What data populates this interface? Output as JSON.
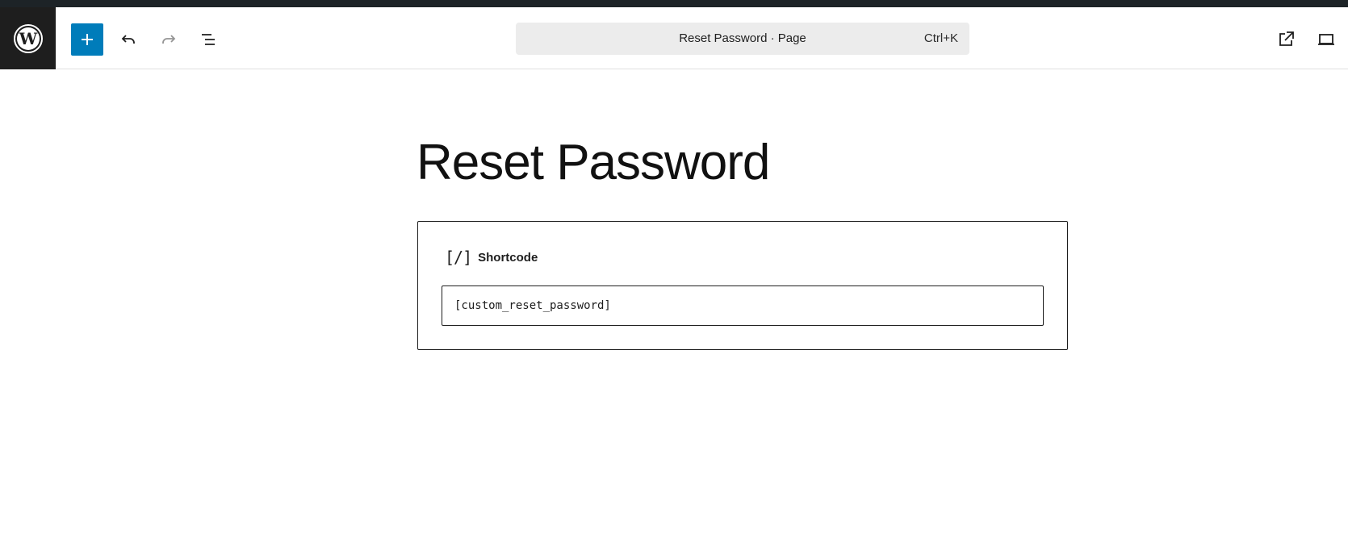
{
  "toolbar": {
    "logo_icon": "wordpress-logo-icon",
    "add_icon": "plus-icon",
    "undo_icon": "undo-icon",
    "redo_icon": "redo-icon",
    "list_view_icon": "list-view-icon",
    "accent_color": "#007cba",
    "view_icon": "external-link-icon",
    "preview_icon": "laptop-icon"
  },
  "command_bar": {
    "title": "Reset Password · Page",
    "shortcut": "Ctrl+K"
  },
  "editor": {
    "page_title": "Reset Password",
    "block": {
      "icon_glyph": "[/]",
      "name": "Shortcode",
      "value": "[custom_reset_password]"
    }
  }
}
